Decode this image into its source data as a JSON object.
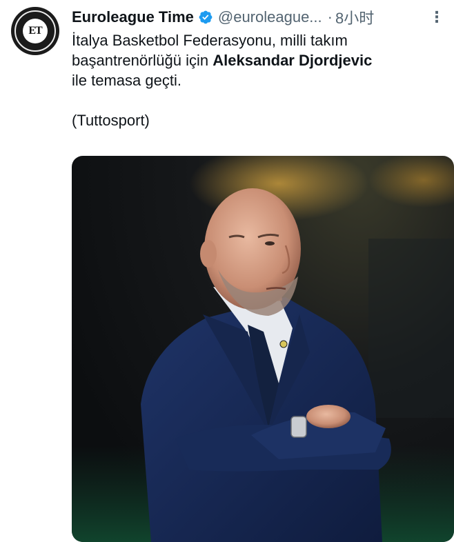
{
  "tweet": {
    "author_name": "Euroleague Time",
    "handle": "@euroleague...",
    "separator": "·",
    "timestamp": "8小时",
    "more_label": "⋮",
    "avatar_initials": "ET",
    "text_line1": "İtalya Basketbol Federasyonu, milli takım",
    "text_line2_prefix": "başantrenörlüğü için ",
    "text_line2_bold": "Aleksandar Djordjevic",
    "text_line3": "ile temasa geçti.",
    "source": "(Tuttosport)"
  },
  "colors": {
    "text_primary": "#0f1419",
    "text_secondary": "#536471",
    "verified_blue": "#1d9bf0"
  },
  "icons": {
    "verified": "verified-badge-icon",
    "more": "more-options-icon"
  }
}
